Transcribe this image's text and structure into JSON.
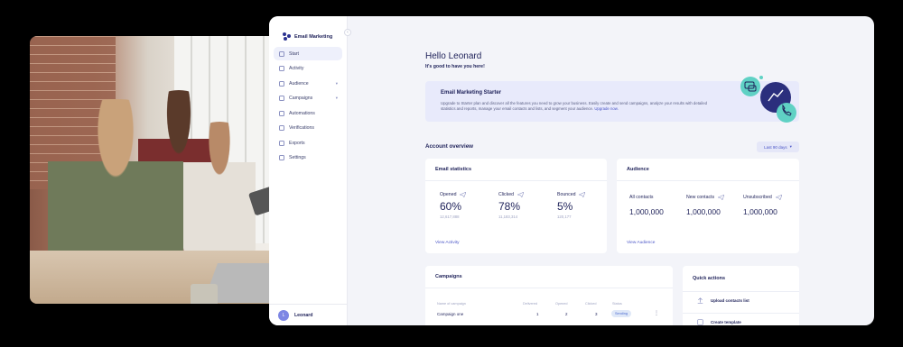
{
  "app": {
    "name": "Email Marketing",
    "collapse_icon": "chevron-left-icon"
  },
  "sidebar": {
    "items": [
      {
        "label": "Start",
        "active": true,
        "icon": "home-icon"
      },
      {
        "label": "Activity",
        "icon": "activity-icon"
      },
      {
        "label": "Audience",
        "icon": "audience-icon",
        "has_submenu": true
      },
      {
        "label": "Campaigns",
        "icon": "campaigns-icon",
        "has_submenu": true
      },
      {
        "label": "Automations",
        "icon": "automations-icon"
      },
      {
        "label": "Verifications",
        "icon": "verifications-icon"
      },
      {
        "label": "Exports",
        "icon": "exports-icon"
      },
      {
        "label": "Settings",
        "icon": "settings-icon"
      }
    ],
    "user": {
      "initial": "L",
      "name": "Leonard"
    }
  },
  "header": {
    "greeting": "Hello Leonard",
    "subtitle": "It's good to have you here!"
  },
  "banner": {
    "title": "Email Marketing Starter",
    "text": "Upgrade to Starter plan and discover all the features you need to grow your business. Easily create and send campaigns, analyze your results with detailed statistics and reports, manage your email contacts and lists, and segment your audience.",
    "link": "Upgrade now."
  },
  "overview": {
    "title": "Account overview",
    "range": "Last 90 days"
  },
  "email_stats": {
    "title": "Email statistics",
    "items": [
      {
        "label": "Opened",
        "value": "60%",
        "count": "12,617,888"
      },
      {
        "label": "Clicked",
        "value": "78%",
        "count": "11,183,314"
      },
      {
        "label": "Bounced",
        "value": "5%",
        "count": "120,177"
      }
    ],
    "link": "View Activity"
  },
  "audience": {
    "title": "Audience",
    "items": [
      {
        "label": "All contacts",
        "value": "1,000,000"
      },
      {
        "label": "New contacts",
        "value": "1,000,000"
      },
      {
        "label": "Unsubscribed",
        "value": "1,000,000"
      }
    ],
    "link": "View Audience"
  },
  "campaigns": {
    "title": "Campaigns",
    "columns": [
      "Name of campaign",
      "Delivered",
      "Opened",
      "Clicked",
      "Status"
    ],
    "rows": [
      {
        "name": "Campaign one",
        "delivered": "1",
        "opened": "2",
        "clicked": "3",
        "status": "Sending"
      }
    ]
  },
  "quick_actions": {
    "title": "Quick actions",
    "items": [
      {
        "label": "Upload contacts list",
        "icon": "upload-icon"
      },
      {
        "label": "Create template",
        "icon": "template-icon"
      }
    ]
  },
  "colors": {
    "accent": "#4b56c7",
    "navy": "#1e2159",
    "banner_bg": "#e8eafb",
    "teal": "#5fd1c4"
  }
}
